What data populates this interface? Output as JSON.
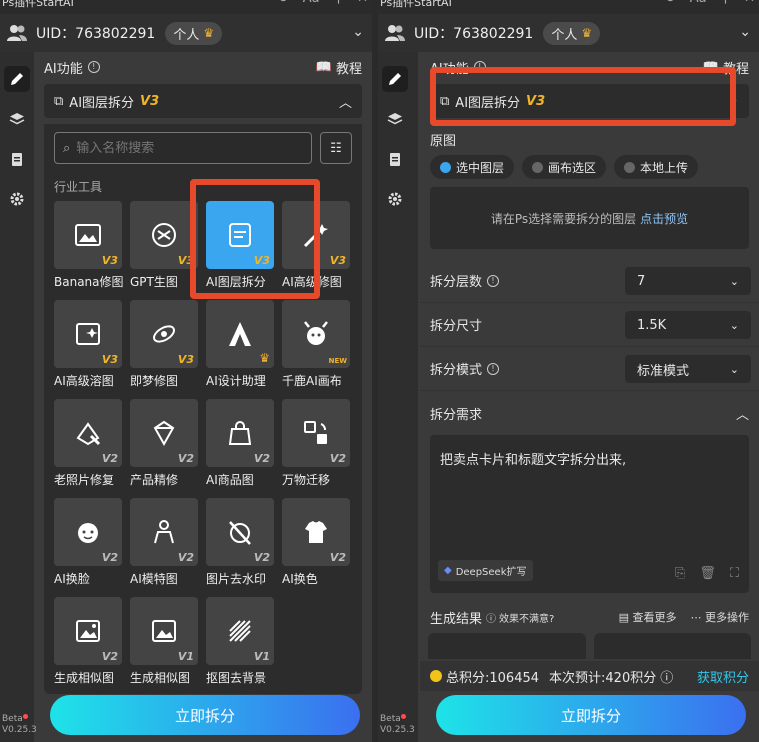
{
  "app_title": "Ps插件StartAI",
  "uid_label": "UID：763802291",
  "plan_label": "个人",
  "ai_func_label": "AI功能",
  "tutorial_label": "教程",
  "selected_tool": "AI图层拆分",
  "selected_tool_version": "V3",
  "search_placeholder": "输入名称搜索",
  "section_industry": "行业工具",
  "tools": [
    {
      "name": "Banana修图",
      "ver": "V3"
    },
    {
      "name": "GPT生图",
      "ver": "V3"
    },
    {
      "name": "AI图层拆分",
      "ver": "V3"
    },
    {
      "name": "AI高级修图",
      "ver": "V3"
    },
    {
      "name": "AI高级溶图",
      "ver": "V3"
    },
    {
      "name": "即梦修图",
      "ver": "V3"
    },
    {
      "name": "AI设计助理",
      "ver": ""
    },
    {
      "name": "千鹿AI画布",
      "ver": "NEW"
    },
    {
      "name": "老照片修复",
      "ver": "V2"
    },
    {
      "name": "产品精修",
      "ver": "V2"
    },
    {
      "name": "AI商品图",
      "ver": "V2"
    },
    {
      "name": "万物迁移",
      "ver": "V2"
    },
    {
      "name": "AI换脸",
      "ver": "V2"
    },
    {
      "name": "AI模特图",
      "ver": "V2"
    },
    {
      "name": "图片去水印",
      "ver": "V2"
    },
    {
      "name": "AI换色",
      "ver": "V2"
    },
    {
      "name": "生成相似图",
      "ver": "V2"
    },
    {
      "name": "生成相似图",
      "ver": "V1"
    },
    {
      "name": "抠图去背景",
      "ver": "V1"
    }
  ],
  "primary_button": "立即拆分",
  "beta_label": "Beta",
  "version_label": "V0.25.3",
  "right": {
    "source_label": "原图",
    "radio_options": [
      "选中图层",
      "画布选区",
      "本地上传"
    ],
    "preview_hint": "请在Ps选择需要拆分的图层",
    "preview_link": "点击预览",
    "layers_label": "拆分层数",
    "layers_value": "7",
    "size_label": "拆分尺寸",
    "size_value": "1.5K",
    "mode_label": "拆分模式",
    "mode_value": "标准模式",
    "need_label": "拆分需求",
    "need_text": "把卖点卡片和标题文字拆分出来,",
    "deepseek_label": "DeepSeek扩写",
    "result_label": "生成结果",
    "unsatisfied": "效果不满意?",
    "view_more": "查看更多",
    "more_ops": "更多操作",
    "total_points": "总积分:106454",
    "est_points": "本次预计:420积分",
    "get_points": "获取积分"
  },
  "colors": {
    "accent": "#3aa6f0",
    "highlight": "#e74a2a",
    "version": "#f0b429"
  }
}
